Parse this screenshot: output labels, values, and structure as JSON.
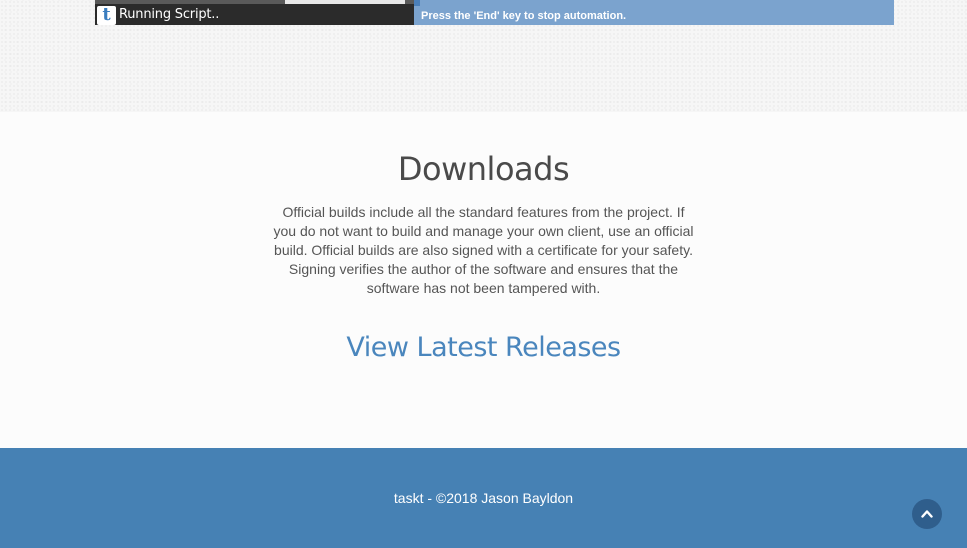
{
  "overlay": {
    "script_window_title": "Running Script..",
    "logo_letter": "t",
    "status_message": "Press the 'End' key to stop automation."
  },
  "downloads": {
    "heading": "Downloads",
    "description": "Official builds include all the standard features from the project. If you do not want to build and manage your own client, use an official build. Official builds are also signed with a certificate for your safety. Signing verifies the author of the software and ensures that the software has not been tampered with.",
    "link_label": "View Latest Releases"
  },
  "footer": {
    "credit": "taskt - ©2018 Jason Bayldon"
  },
  "icons": {
    "back_to_top": "chevron-up-icon",
    "logo": "taskt-logo-icon"
  },
  "colors": {
    "footer_bg": "#4681b4",
    "link": "#4a86bd",
    "status_bar": "#7ba3ce",
    "back_to_top_bg": "#2f5e8c"
  }
}
